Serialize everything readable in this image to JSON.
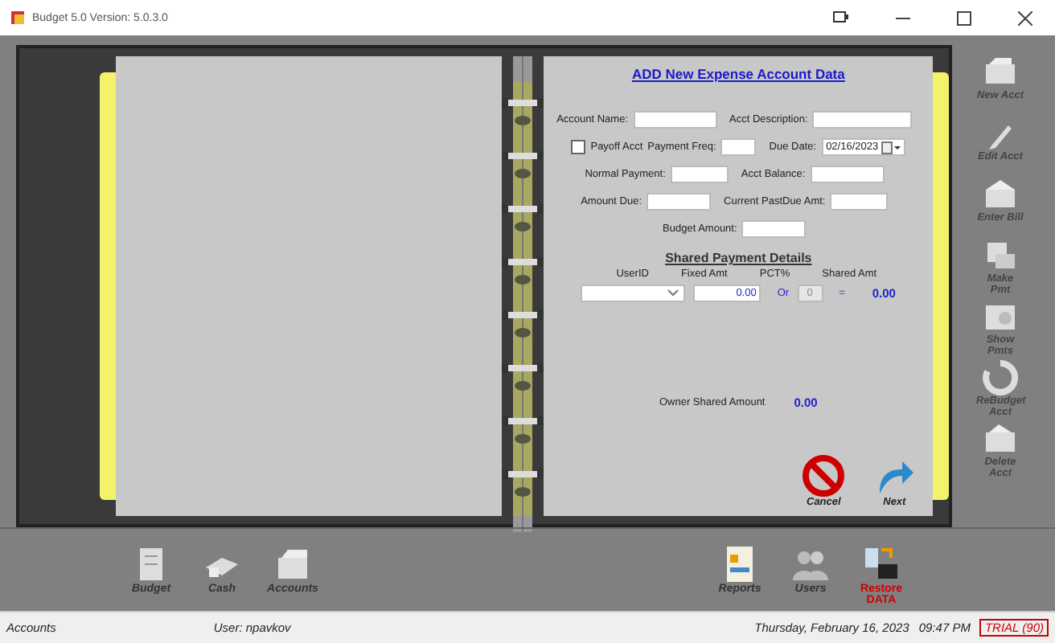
{
  "window": {
    "title": "Budget 5.0 Version: 5.0.3.0"
  },
  "form": {
    "heading": "ADD New Expense Account Data",
    "rows": [
      [
        {
          "kind": "field",
          "label": "Account Name:"
        },
        {
          "kind": "field",
          "label": "Acct Description:"
        }
      ],
      [
        {
          "kind": "checkbox",
          "label": "Payoff Acct",
          "checked": false
        },
        {
          "kind": "field",
          "label": "Payment Freq:"
        },
        {
          "kind": "date",
          "label": "Due Date:",
          "value": "02/16/2023"
        }
      ],
      [
        {
          "kind": "field",
          "label": "Normal Payment:"
        },
        {
          "kind": "field",
          "label": "Acct Balance:"
        }
      ],
      [
        {
          "kind": "field",
          "label": "Amount Due:"
        },
        {
          "kind": "field",
          "label": "Current PastDue Amt:"
        }
      ],
      [
        {
          "kind": "field",
          "label": "Budget Amount:"
        }
      ]
    ],
    "shared": {
      "heading": "Shared Payment Details",
      "columns": [
        "UserID",
        "Fixed Amt",
        "PCT%",
        "Shared Amt"
      ],
      "row": {
        "fixed": "0.00",
        "or": "Or",
        "pct": "0",
        "equals": "=",
        "shared": "0.00"
      }
    },
    "owner": {
      "label": "Owner Shared Amount",
      "value": "0.00"
    },
    "buttons": [
      {
        "kind": "cancel",
        "label": "Cancel"
      },
      {
        "kind": "next",
        "label": "Next"
      }
    ]
  },
  "side_toolbar": [
    "New Acct",
    "Edit Acct",
    "Enter Bill",
    "Make Pmt",
    "Show Pmts",
    "ReBudget Acct",
    "Delete Acct"
  ],
  "bottom_toolbar": {
    "left": [
      {
        "label": "Budget",
        "highlight": false
      },
      {
        "label": "Cash",
        "highlight": false
      },
      {
        "label": "Accounts",
        "highlight": false
      }
    ],
    "right": [
      {
        "label": "Reports",
        "highlight": false
      },
      {
        "label": "Users",
        "highlight": false
      },
      {
        "label": "Restore DATA",
        "highlight": true
      }
    ]
  },
  "status_bar": {
    "section": "Accounts",
    "user": "User: npavkov",
    "date": "Thursday, February 16, 2023",
    "time": "09:47 PM",
    "trial": "TRIAL (90)"
  }
}
